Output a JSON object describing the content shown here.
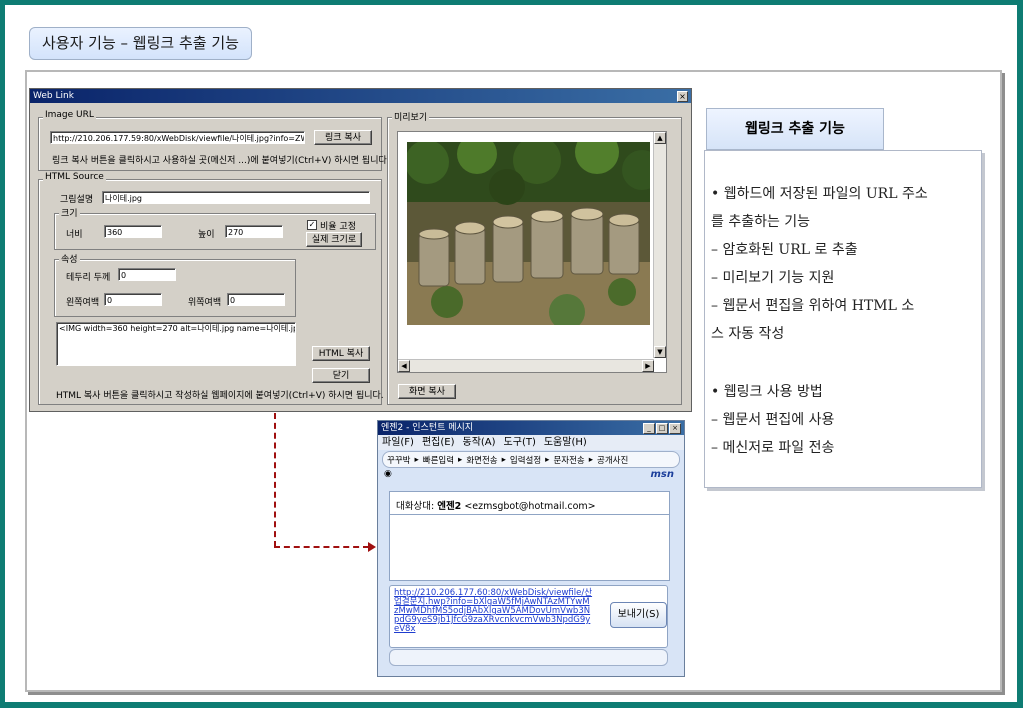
{
  "page": {
    "heading": "사용자 기능 – 웹링크 추출 기능"
  },
  "weblink": {
    "title": "Web Link",
    "close": "×",
    "image_url_group": "Image URL",
    "url_value": "http://210.206.177.59:80/xWebDisk/viewfile/나이테.jpg?info=ZW56",
    "copy_link_button": "링크 복사",
    "url_hint": "링크 복사 버튼을 클릭하시고 사용하실 곳(메신저 ...)에 붙여넣기(Ctrl+V) 하시면 됩니다.",
    "html_source_group": "HTML Source",
    "desc_label": "그림설명",
    "desc_value": "나이테.jpg",
    "size_group": "크기",
    "width_label": "너비",
    "width_value": "360",
    "height_label": "높이",
    "height_value": "270",
    "keep_ratio_label": "비율 고정",
    "keep_ratio_checked": "✓",
    "actual_size_button": "실제 크기로",
    "attr_group": "속성",
    "border_label": "테두리 두께",
    "border_value": "0",
    "hspace_label": "왼쪽여백",
    "hspace_value": "0",
    "vspace_label": "위쪽여백",
    "vspace_value": "0",
    "html_code": "<IMG width=360 height=270 alt=나이테.jpg name=나이테.jpg hs",
    "html_copy_button": "HTML 복사",
    "close_button": "닫기",
    "html_hint": "HTML 복사 버튼을 클릭하시고 작성하실 웹페이지에 붙여넣기(Ctrl+V) 하시면 됩니다.",
    "preview_group": "미리보기",
    "screen_copy_button": "화면 복사"
  },
  "right_panel": {
    "title": "웹링크 추출 기능",
    "lines": [
      "• 웹하드에 저장된 파일의 URL 주소",
      "를 추출하는 기능",
      " – 암호화된 URL 로 추출",
      " – 미리보기 기능 지원",
      " –  웹문서 편집을 위하여 HTML 소",
      "스 자동 작성",
      "• 웹링크 사용 방법",
      " – 웹문서 편집에 사용",
      " – 메신저로 파일 전송"
    ]
  },
  "messenger": {
    "title": "엔젠2 - 인스턴트 메시지",
    "menu": [
      "파일(F)",
      "편집(E)",
      "동작(A)",
      "도구(T)",
      "도움말(H)"
    ],
    "toolbar": [
      "빠른입력",
      "화면전송",
      "입력설정",
      "문자전송",
      "공개사진"
    ],
    "toolbar_lead": "꾸꾸박",
    "brand": "msn",
    "chat_label": "대화상대:",
    "chat_name": "엔젠2",
    "chat_email": "<ezmsgbot@hotmail.com>",
    "link_text": "http://210.206.177.60:80/xWebDisk/viewfile/산업결문지.hwp?info=bXlgaW5fMjAwNTAzMTYwMzMwMDhfMS5odjBAbXlgaW5AMDovUmVwb3NpdG9yeS9jb1JfcG9zaXRvcnkvcmVwb3NpdG9yeV8x",
    "send_button": "보내기(S)"
  },
  "colors": {
    "page_border": "#0e7c73",
    "accent_arrow": "#a01010"
  }
}
